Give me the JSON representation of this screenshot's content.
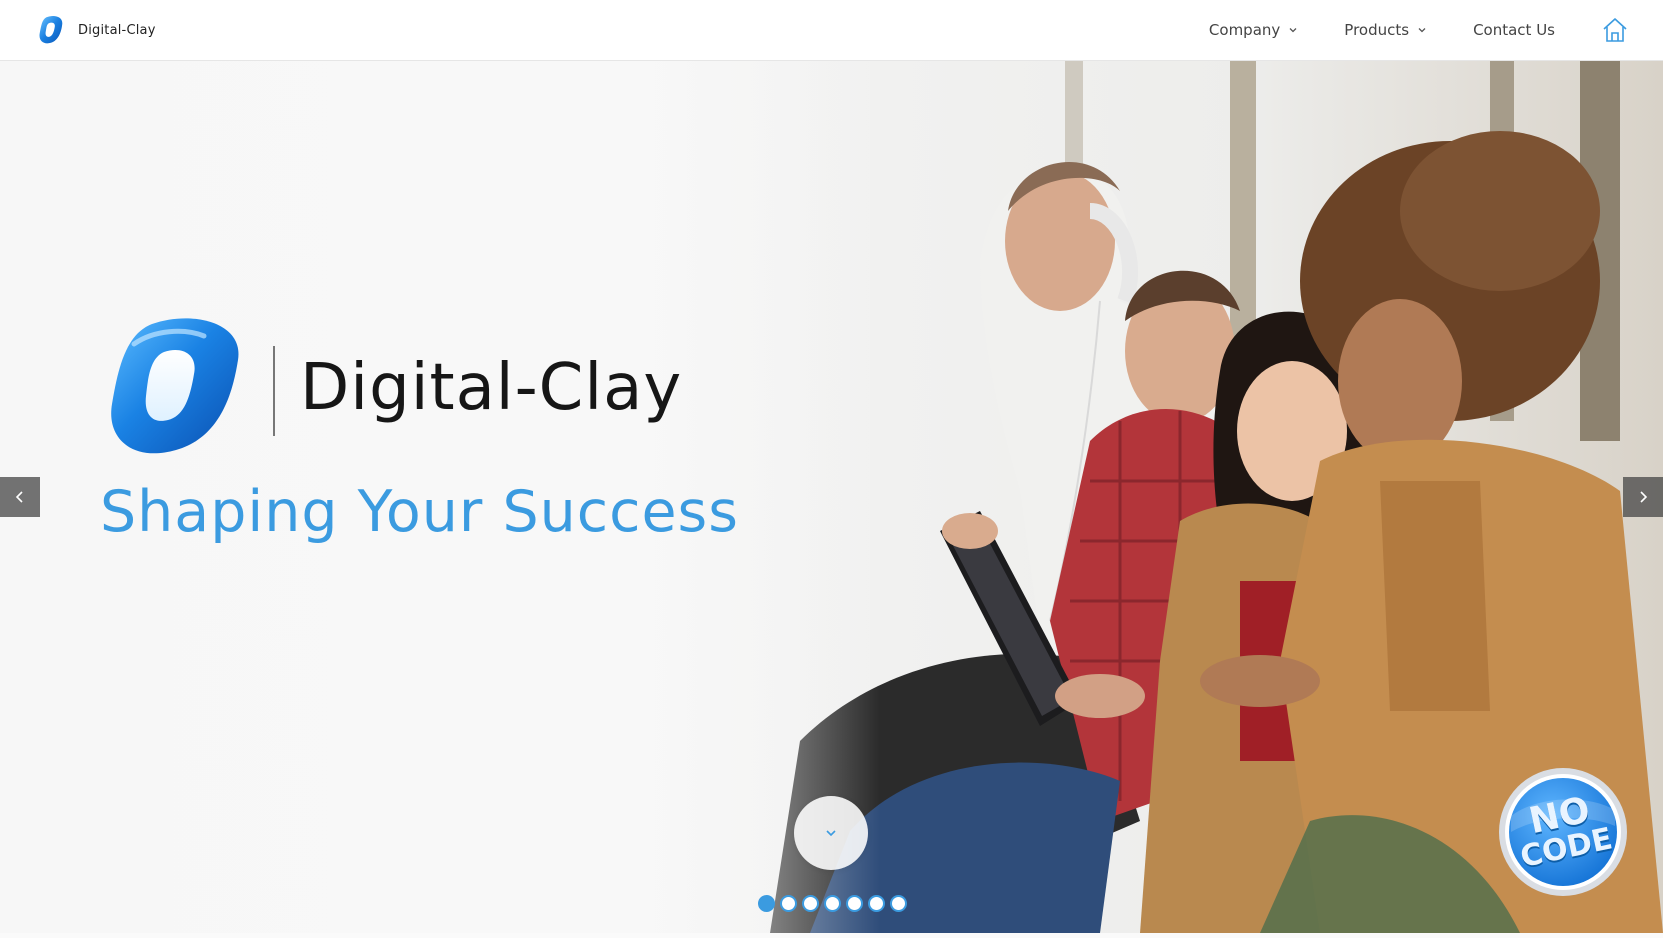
{
  "header": {
    "brand_name": "Digital-Clay",
    "nav": [
      {
        "label": "Company",
        "has_dropdown": true
      },
      {
        "label": "Products",
        "has_dropdown": true
      },
      {
        "label": "Contact Us",
        "has_dropdown": false
      }
    ],
    "home_icon": "home-icon"
  },
  "hero": {
    "brand_name": "Digital-Clay",
    "tagline": "Shaping Your Success",
    "badge": {
      "line1": "NO",
      "line2": "CODE"
    },
    "slides": {
      "count": 7,
      "active": 1
    },
    "icons": {
      "prev": "chevron-left-icon",
      "next": "chevron-right-icon",
      "scroll": "chevron-down-icon"
    }
  },
  "colors": {
    "accent": "#3b9be0",
    "logo_blue": "#1a7fe0",
    "text_dark": "#161616",
    "nav_text": "#444444"
  }
}
